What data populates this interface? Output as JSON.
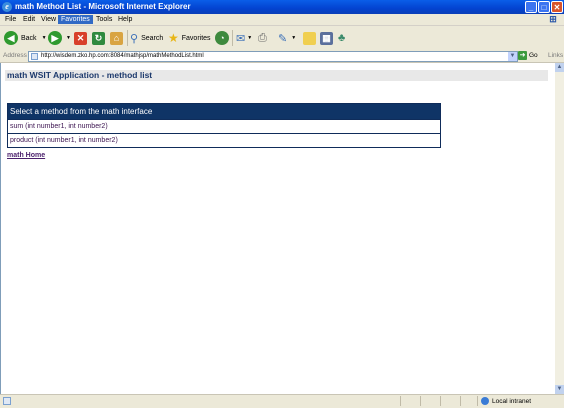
{
  "window": {
    "title": "math Method List - Microsoft Internet Explorer",
    "min": "_",
    "max": "□",
    "close": "✕"
  },
  "menu": [
    "File",
    "Edit",
    "View",
    "Favorites",
    "Tools",
    "Help"
  ],
  "toolbar": {
    "back": "Back",
    "search": "Search",
    "favorites": "Favorites"
  },
  "address": {
    "label": "Address",
    "url": "http://wisdem.zko.hp.com:8084/mathjsp/mathMethodList.html",
    "go": "Go",
    "links": "Links"
  },
  "page": {
    "heading": "math WSIT Application - method list",
    "table_header": "Select a method from the math interface",
    "methods": [
      "sum (int number1, int number2)",
      "product (int number1, int number2)"
    ],
    "home_link": "math Home"
  },
  "status": {
    "zone": "Local intranet"
  }
}
